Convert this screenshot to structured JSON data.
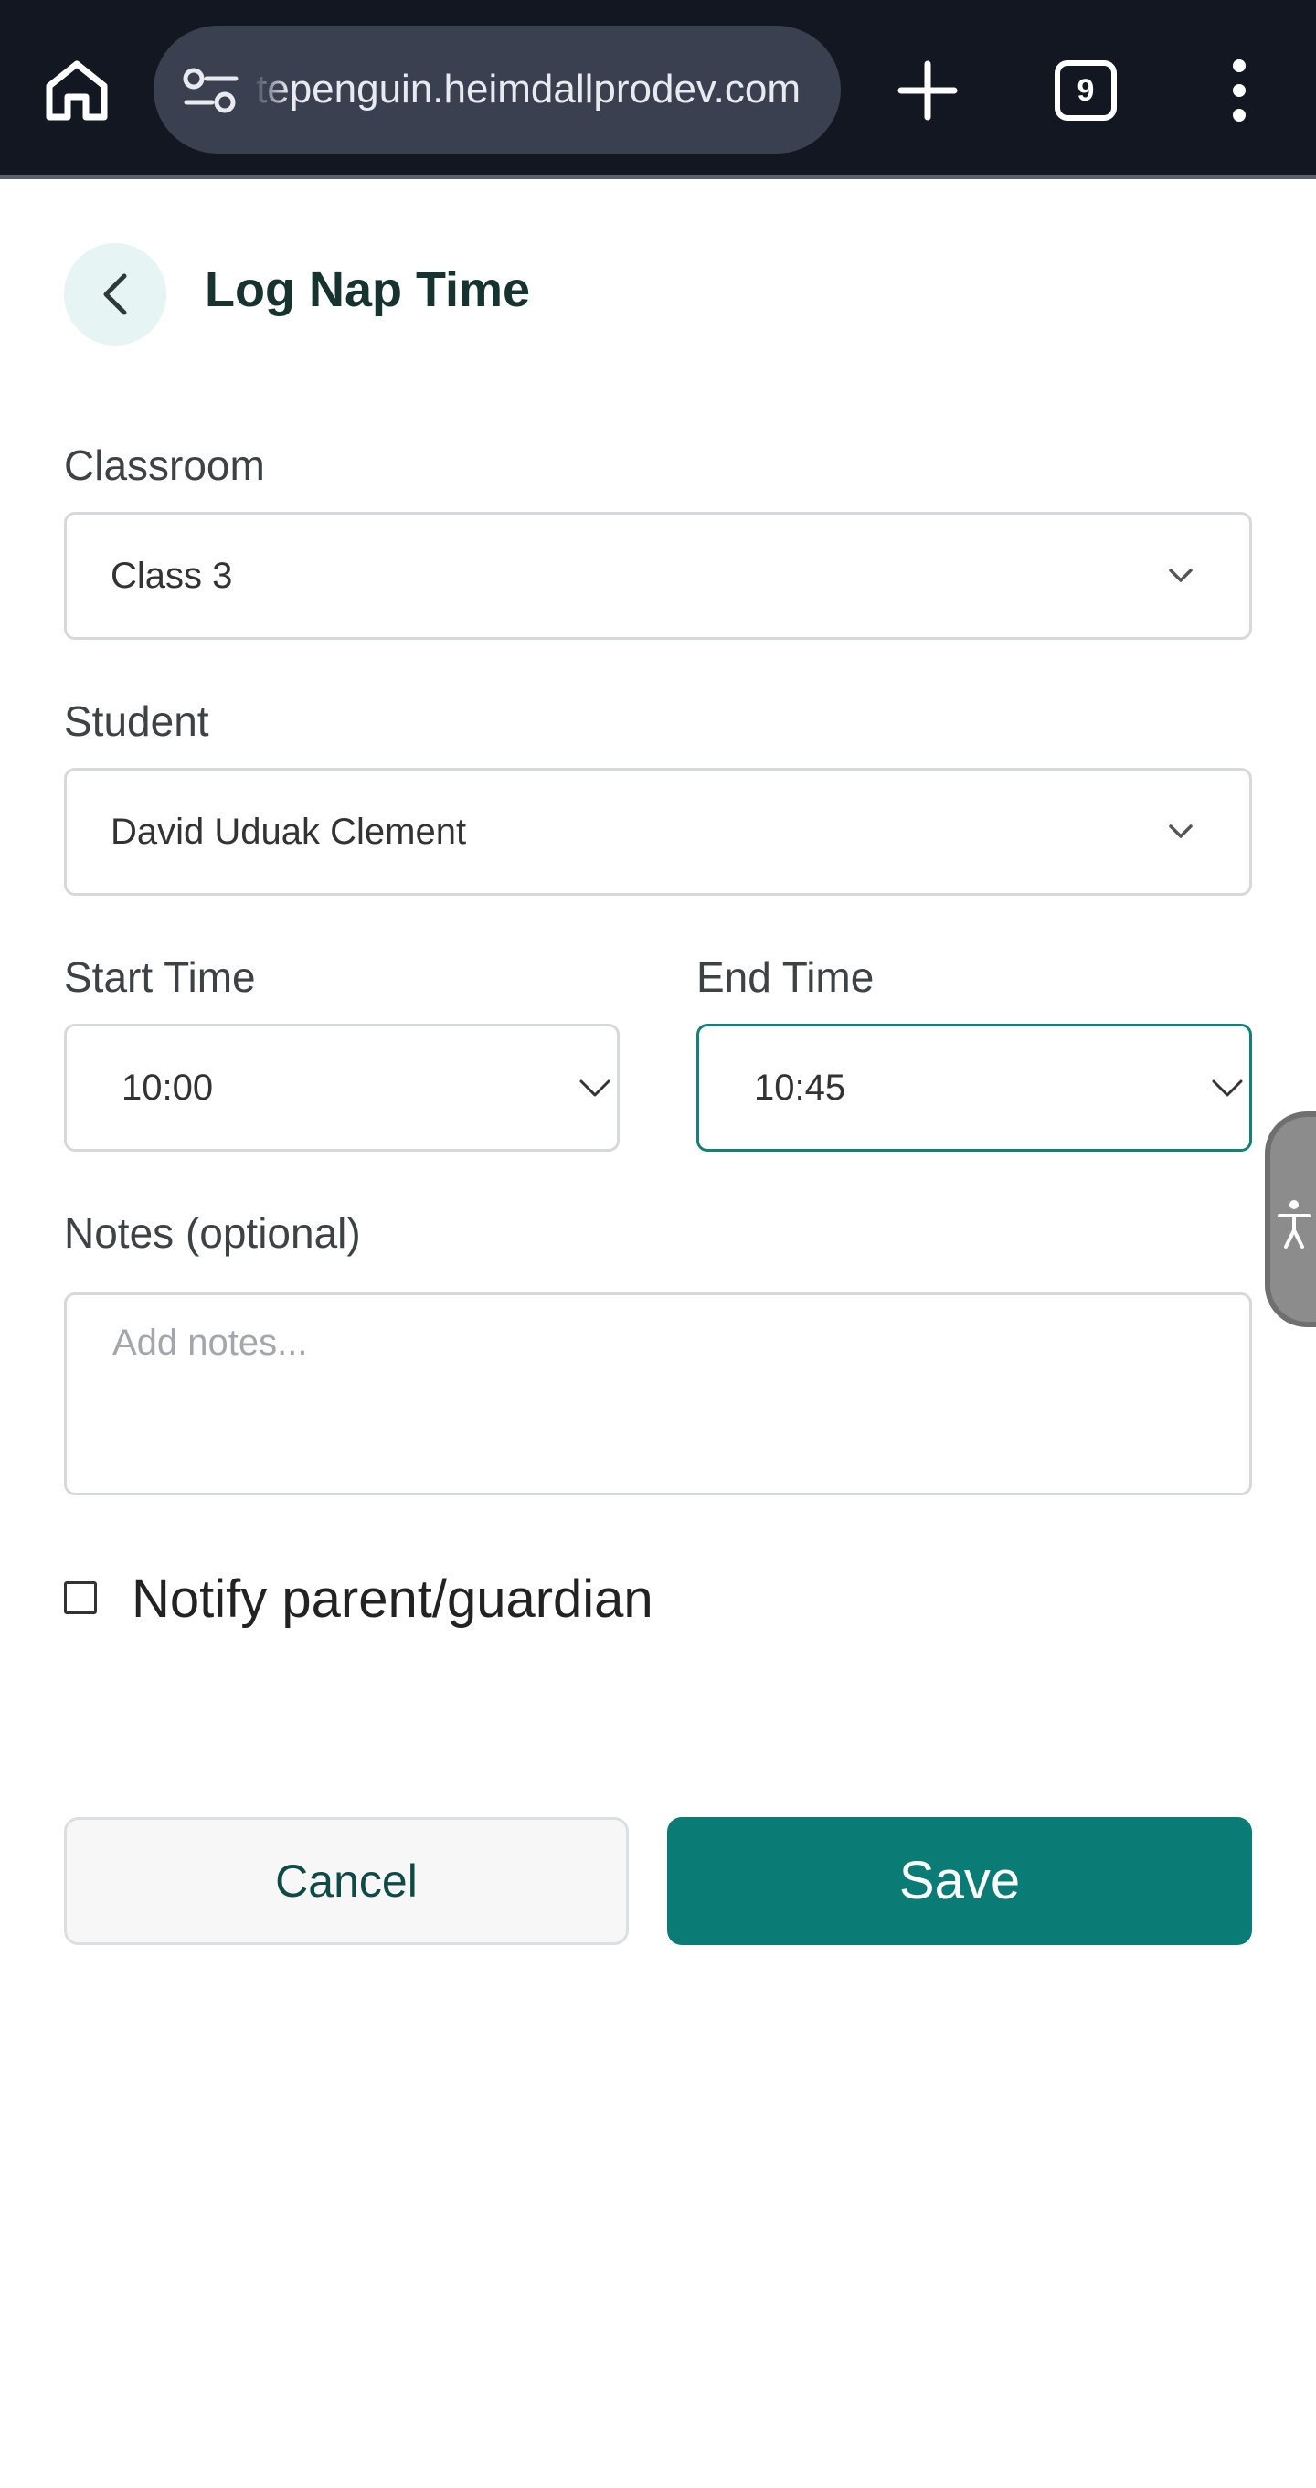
{
  "browser": {
    "url": "tepenguin.heimdallprodev.com",
    "tab_count": "9",
    "icons": [
      "home-icon",
      "site-settings-icon",
      "plus-icon",
      "tabs-icon",
      "more-vert-icon"
    ]
  },
  "header": {
    "title": "Log Nap Time",
    "back_icon": "chevron-left-icon"
  },
  "form": {
    "classroom": {
      "label": "Classroom",
      "value": "Class 3"
    },
    "student": {
      "label": "Student",
      "value": "David Uduak Clement"
    },
    "start_time": {
      "label": "Start Time",
      "value": "10:00"
    },
    "end_time": {
      "label": "End Time",
      "value": "10:45"
    },
    "notes": {
      "label": "Notes (optional)",
      "placeholder": "Add notes...",
      "value": ""
    },
    "notify": {
      "label": "Notify parent/guardian",
      "checked": false
    }
  },
  "actions": {
    "cancel_label": "Cancel",
    "save_label": "Save"
  },
  "colors": {
    "accent": "#0b7b76",
    "title": "#163330",
    "browser_bar": "#121722"
  },
  "accessibility_widget": {
    "icon": "accessibility-icon"
  }
}
